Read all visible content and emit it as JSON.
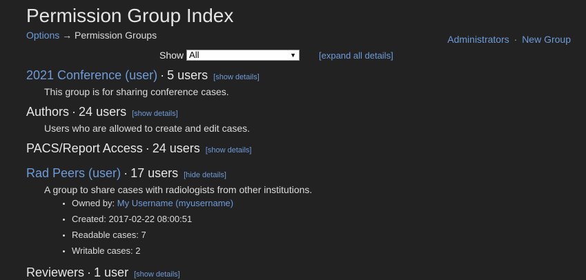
{
  "page": {
    "title": "Permission Group Index"
  },
  "breadcrumb": {
    "options": "Options",
    "arrow": "→",
    "current": "Permission Groups"
  },
  "top_links": {
    "administrators": "Administrators",
    "separator": "·",
    "new_group": "New Group"
  },
  "filter": {
    "label": "Show",
    "selected": "All",
    "expand_all": "[expand all details]"
  },
  "groups": [
    {
      "name": "2021 Conference (user)",
      "is_link": true,
      "count": "5 users",
      "toggle": "[show details]",
      "description": "This group is for sharing conference cases."
    },
    {
      "name": "Authors",
      "is_link": false,
      "count": "24 users",
      "toggle": "[show details]",
      "description": "Users who are allowed to create and edit cases."
    },
    {
      "name": "PACS/Report Access",
      "is_link": false,
      "count": "24 users",
      "toggle": "[show details]",
      "description": ""
    },
    {
      "name": "Rad Peers (user)",
      "is_link": true,
      "count": "17 users",
      "toggle": "[hide details]",
      "description": "A group to share cases with radiologists from other institutions.",
      "details": {
        "owned_by_label": "Owned by:",
        "owned_by_value": "My Username (myusername)",
        "created": "Created: 2017-02-22 08:00:51",
        "readable": "Readable cases: 7",
        "writable": "Writable cases: 2"
      }
    },
    {
      "name": "Reviewers",
      "is_link": false,
      "count": "1 user",
      "toggle": "[show details]",
      "description": ""
    }
  ],
  "separator_dot": "·",
  "colors": {
    "background": "#222222",
    "link": "#6f9bd8",
    "text": "#e6e6e6"
  }
}
